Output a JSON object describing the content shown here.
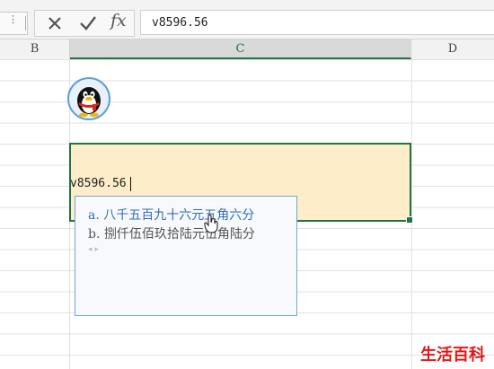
{
  "formula_bar": {
    "name_box_dropdown": "⋮",
    "cancel_icon": "close-icon",
    "enter_icon": "check-icon",
    "fx_label": "fx",
    "formula_value": "v8596.56"
  },
  "columns": [
    {
      "label": "B"
    },
    {
      "label": "C"
    },
    {
      "label": "D"
    }
  ],
  "cell": {
    "edit_value": "v8596.56",
    "fill_color": "#fdedc8",
    "border_color": "#217346"
  },
  "suggestions": {
    "options": [
      {
        "label": "a. 八千五百九十六元五角六分"
      },
      {
        "label": "b. 捌仟伍佰玖拾陆元伍角陆分"
      }
    ],
    "pager": "◂ ▸"
  },
  "watermark": "生活百科",
  "colors": {
    "accent_green": "#217346",
    "popup_border": "#6fa8dc",
    "option_highlight": "#2f6fb5",
    "watermark": "#e01818"
  }
}
